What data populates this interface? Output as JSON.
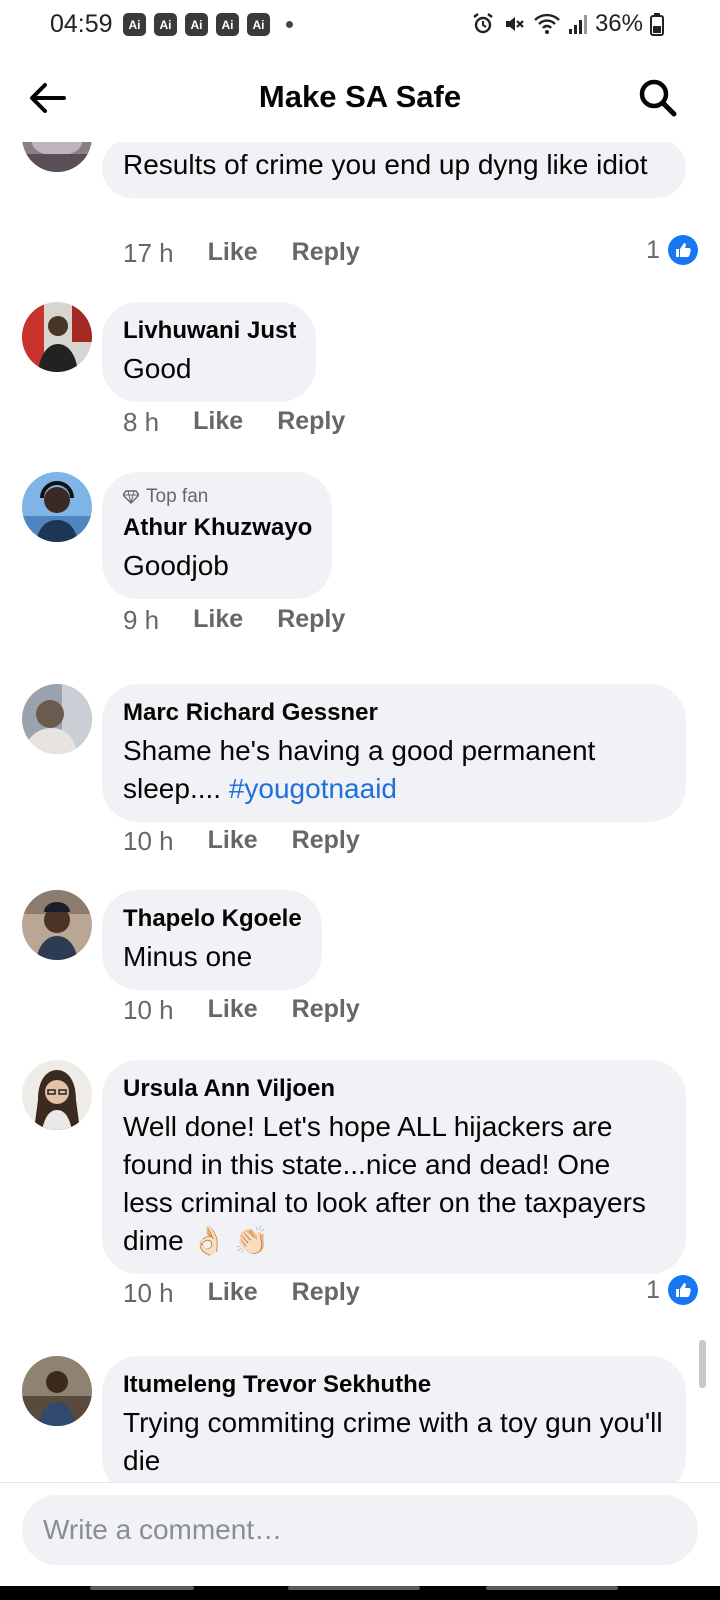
{
  "status_bar": {
    "time": "04:59",
    "ai_badges": [
      "Ai",
      "Ai",
      "Ai",
      "Ai",
      "Ai"
    ],
    "battery": "36%",
    "icons": [
      "alarm-icon",
      "mute-icon",
      "wifi-icon",
      "signal-icon",
      "battery-icon"
    ]
  },
  "header": {
    "title": "Make SA Safe",
    "back_icon": "back-arrow-icon",
    "search_icon": "search-icon"
  },
  "comments": [
    {
      "author": "",
      "text": "Results of crime you end up dyng like idiot",
      "time": "17 h",
      "like": "Like",
      "reply": "Reply",
      "reactions": "1"
    },
    {
      "author": "Livhuwani Just",
      "text": "Good",
      "time": "8 h",
      "like": "Like",
      "reply": "Reply"
    },
    {
      "badge": "Top fan",
      "author": "Athur Khuzwayo",
      "text": "Goodjob",
      "time": "9 h",
      "like": "Like",
      "reply": "Reply"
    },
    {
      "author": "Marc Richard Gessner",
      "text": "Shame he's having a good permanent sleep.... ",
      "hashtag": "#yougotnaaid",
      "time": "10 h",
      "like": "Like",
      "reply": "Reply"
    },
    {
      "author": "Thapelo Kgoele",
      "text": "Minus one",
      "time": "10 h",
      "like": "Like",
      "reply": "Reply"
    },
    {
      "author": "Ursula Ann Viljoen",
      "text": "Well done! Let's hope ALL hijackers are found in this state...nice and dead! One less criminal to look after on the taxpayers dime 👌🏻 👏🏻",
      "time": "10 h",
      "like": "Like",
      "reply": "Reply",
      "reactions": "1"
    },
    {
      "author": "Itumeleng Trevor Sekhuthe",
      "text": "Trying commiting crime with a toy gun you'll die"
    }
  ],
  "composer": {
    "placeholder": "Write a comment…"
  },
  "colors": {
    "bubble": "#f0f2f5",
    "meta": "#65676b",
    "link": "#216fdb",
    "like_blue": "#1877f2"
  }
}
